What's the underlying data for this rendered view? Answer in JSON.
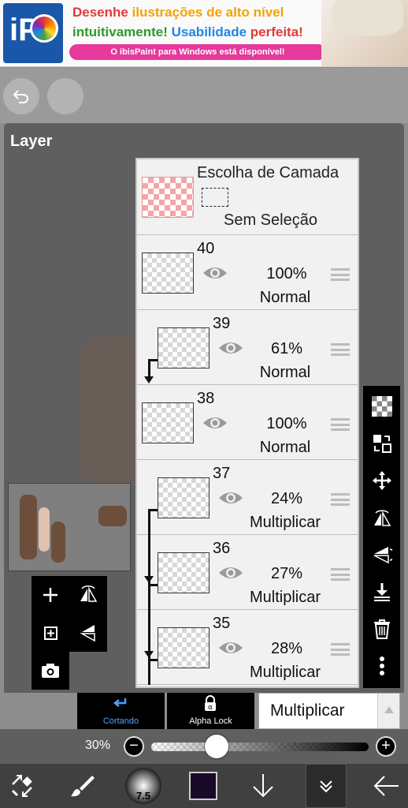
{
  "ad": {
    "line1_a": "Desenhe",
    "line1_b": " ilustrações de alto nível",
    "line2_a": "intuitivamente! ",
    "line2_b": "Usabilidade ",
    "line2_c": "perfeita!",
    "pill": "O ibisPaint para Windows está disponível!",
    "logo_text": "iP"
  },
  "panel": {
    "title": "Layer"
  },
  "layer_select": {
    "title": "Escolha de Camada",
    "none": "Sem Seleção"
  },
  "layers": [
    {
      "number": "40",
      "opacity": "100%",
      "blend": "Normal",
      "clipped": false
    },
    {
      "number": "39",
      "opacity": "61%",
      "blend": "Normal",
      "clipped": true
    },
    {
      "number": "38",
      "opacity": "100%",
      "blend": "Normal",
      "clipped": false
    },
    {
      "number": "37",
      "opacity": "24%",
      "blend": "Multiplicar",
      "clipped": true
    },
    {
      "number": "36",
      "opacity": "27%",
      "blend": "Multiplicar",
      "clipped": true
    },
    {
      "number": "35",
      "opacity": "28%",
      "blend": "Multiplicar",
      "clipped": true
    }
  ],
  "modes": {
    "clipping": "Cortando",
    "alpha_lock": "Alpha Lock",
    "blend_mode": "Multiplicar"
  },
  "opacity_slider": {
    "label": "30%",
    "value": 0.3
  },
  "brush": {
    "size": "7.5"
  },
  "colors": {
    "current": "#1a0a2a",
    "panel": "#5f5f5f",
    "accent": "#4aa3ff"
  }
}
